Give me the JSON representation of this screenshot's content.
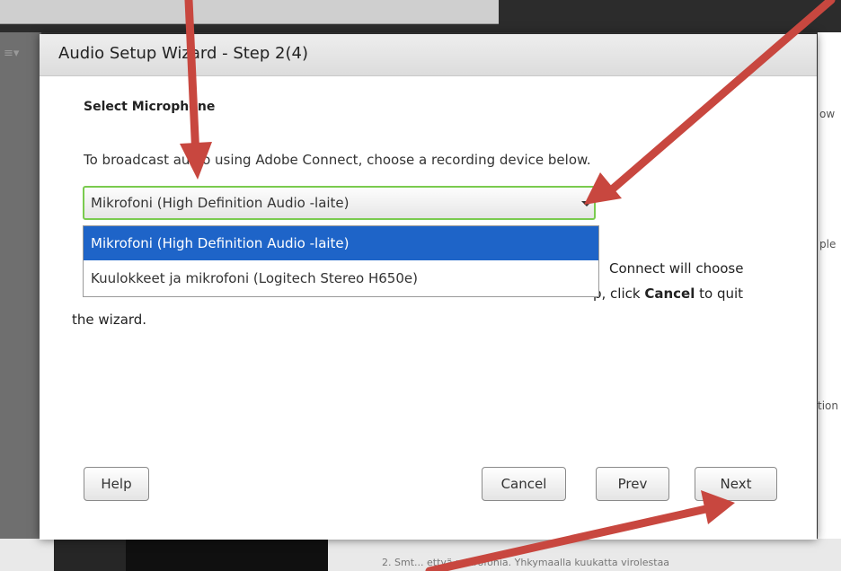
{
  "dialog": {
    "title": "Audio Setup Wizard - Step 2(4)",
    "section_title": "Select Microphone",
    "instruction": "To broadcast audio using Adobe Connect, choose a recording device below.",
    "select_value": "Mikrofoni (High Definition Audio -laite)",
    "options": [
      "Mikrofoni (High Definition Audio -laite)",
      "Kuulokkeet ja mikrofoni (Logitech Stereo H650e)"
    ],
    "hidden_text": {
      "line1_end": "Connect will choose",
      "line2_end_prefix": "p, click ",
      "line2_bold": "Cancel",
      "line2_suffix": " to quit",
      "line3": "the wizard."
    },
    "buttons": {
      "help": "Help",
      "cancel": "Cancel",
      "prev": "Prev",
      "next": "Next"
    }
  },
  "background": {
    "right_fragments": [
      "ow",
      "ple",
      "tion"
    ],
    "bottom_text": "2. Smt... ettyä mikrofonia. Yhkymaalla kuukatta virolestaa"
  },
  "colors": {
    "accent": "#1e64c8",
    "focus_border": "#7acb4f",
    "annotation_arrow": "#c8473f"
  }
}
